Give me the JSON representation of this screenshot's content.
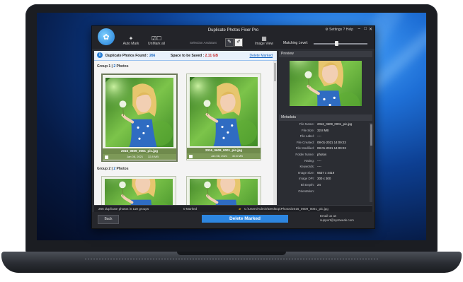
{
  "app": {
    "title": "Duplicate Photos Fixer Pro",
    "toolbar": {
      "auto_mark": "Auto Mark",
      "unmark_all": "UnMark all",
      "selection_assistant": "Selection Assistant",
      "image_view": "Image View",
      "settings": "Settings",
      "help": "Help",
      "matching_level_label": "Matching Level:",
      "matching_level_value": 0.42
    },
    "info_bar": {
      "found_label": "Duplicate Photos Found :",
      "found_count": "266",
      "space_label": "Space to be Saved :",
      "space_value": "2.11 GB",
      "delete_link": "Delete Marked"
    },
    "groups": [
      {
        "label": "Group 1",
        "photo_count": "2",
        "photos_word": "Photos",
        "items": [
          {
            "filename": "2016_0609_0001_pic.jpg",
            "date": "Jan 08, 2021",
            "size": "32.8 MB",
            "checked": false
          },
          {
            "filename": "2016_0609_0001_pic.jpg",
            "date": "Jan 08, 2021",
            "size": "32.8 MB",
            "checked": false
          }
        ]
      },
      {
        "label": "Group 2",
        "photo_count": "2",
        "photos_word": "Photos"
      }
    ],
    "preview_header": "Preview",
    "metadata_header": "Metadata",
    "metadata": [
      {
        "key": "File Name:",
        "value": "2016_0609_0001_pic.jpg"
      },
      {
        "key": "File Size:",
        "value": "32.8 MB"
      },
      {
        "key": "File Label:",
        "value": "----"
      },
      {
        "key": "File Created:",
        "value": "08-01-2021 14:09:23"
      },
      {
        "key": "File Modified:",
        "value": "08-01-2021 14:09:23"
      },
      {
        "key": "Folder Name:",
        "value": "photos"
      },
      {
        "key": "Rating:",
        "value": "----"
      },
      {
        "key": "Keywords:",
        "value": "----"
      },
      {
        "key": "Image Size:",
        "value": "6637 x 4419"
      },
      {
        "key": "Image DPI:",
        "value": "300 x 300"
      },
      {
        "key": "Bit Depth:",
        "value": "24"
      },
      {
        "key": "Orientation:",
        "value": ""
      }
    ],
    "status": {
      "summary": "266 duplicate photos in 118 groups",
      "marked": "0 Marked",
      "path": "C:\\Users\\Admin\\Desktop\\Photos\\2016_0609_0001_pic.jpg"
    },
    "footer": {
      "back": "Back",
      "delete_marked": "Delete Marked",
      "email_label": "Email us at:",
      "email": "support@systweak.com"
    }
  }
}
